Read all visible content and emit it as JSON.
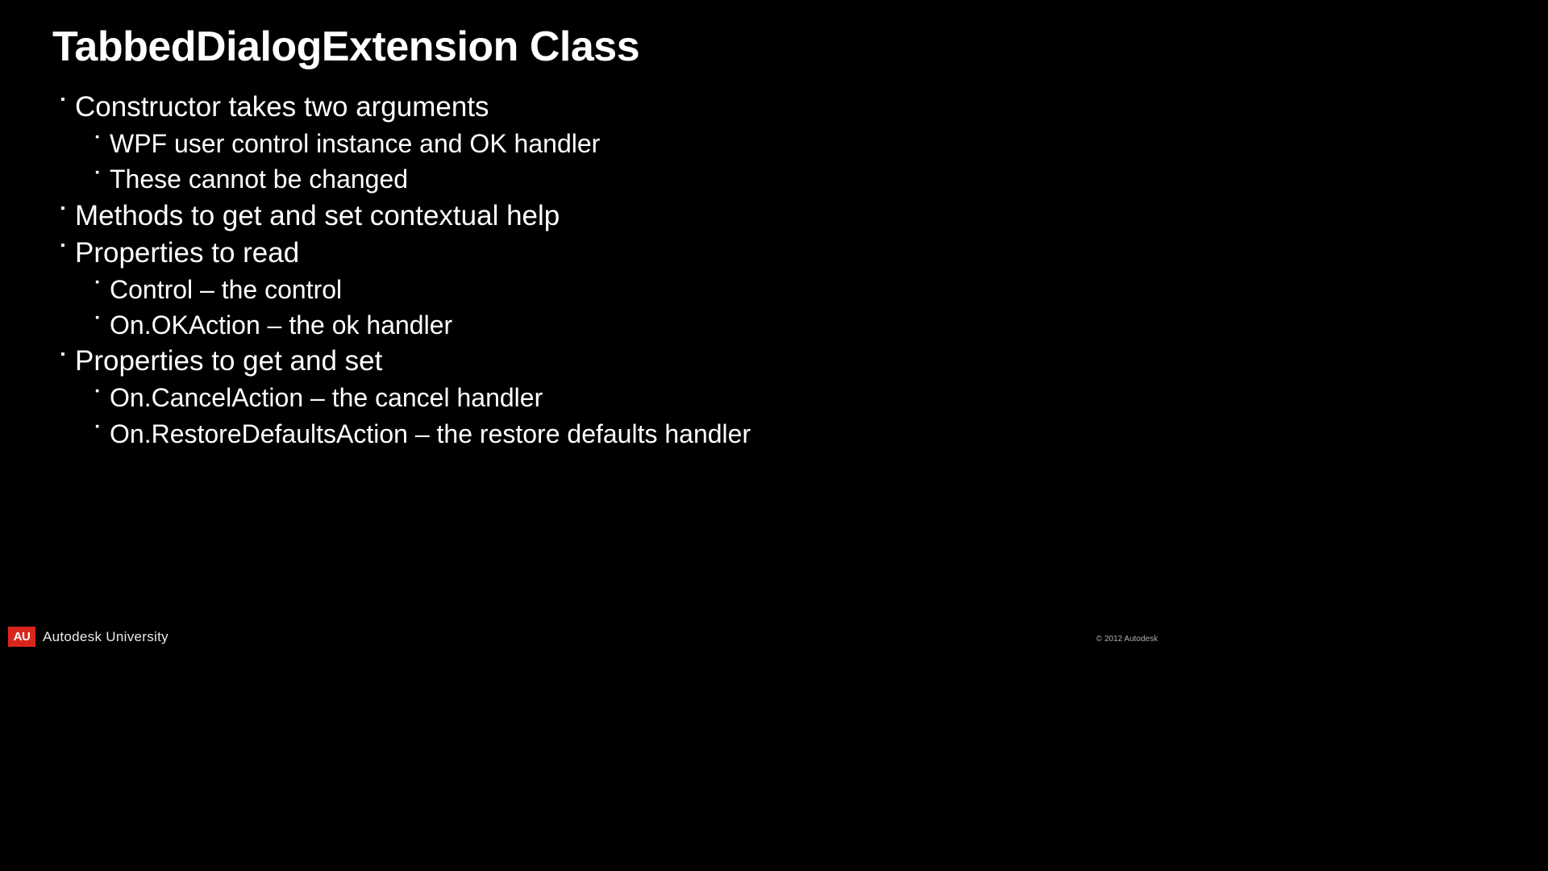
{
  "title": "TabbedDialogExtension Class",
  "bullets": [
    {
      "text": "Constructor takes two arguments",
      "children": [
        "WPF user control instance and OK handler",
        "These cannot be changed"
      ]
    },
    {
      "text": "Methods to get and set contextual help",
      "children": []
    },
    {
      "text": "Properties to read",
      "children": [
        "Control – the control",
        "On.OKAction – the ok handler"
      ]
    },
    {
      "text": "Properties to get and set",
      "children": [
        "On.CancelAction – the cancel handler",
        "On.RestoreDefaultsAction – the restore defaults handler"
      ]
    }
  ],
  "footer": {
    "logo_text": "AU",
    "brand_text": "Autodesk University"
  },
  "copyright": "© 2012 Autodesk"
}
